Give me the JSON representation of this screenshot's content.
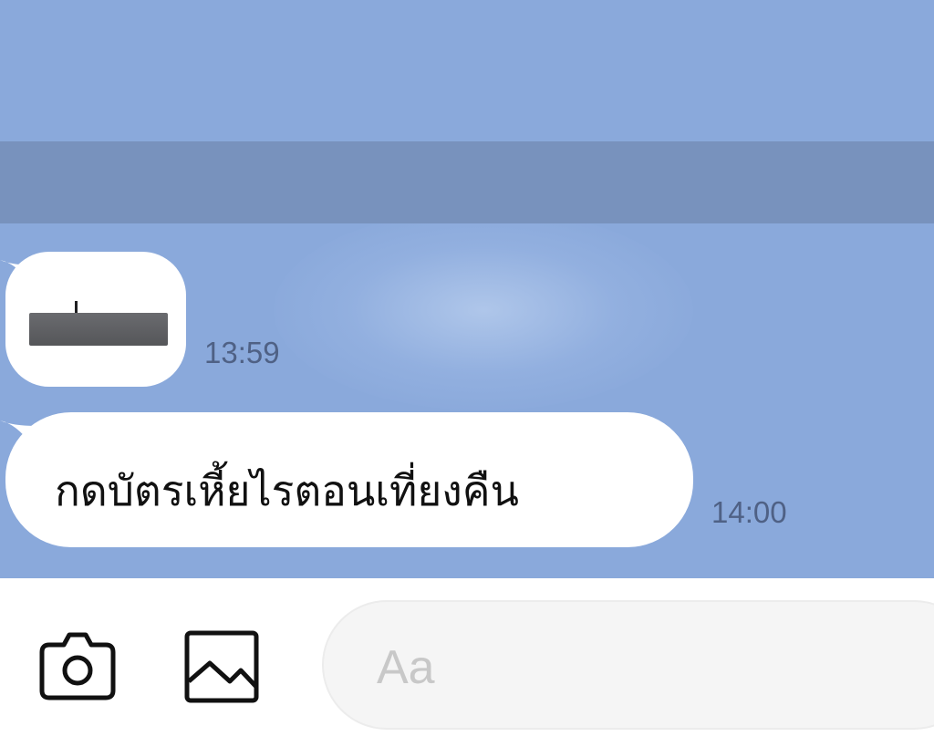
{
  "chat": {
    "messages": [
      {
        "type": "sticker",
        "time": "13:59"
      },
      {
        "type": "text",
        "text": "กดบัตรเหี้ยไรตอนเที่ยงคืน",
        "time": "14:00"
      }
    ]
  },
  "composer": {
    "placeholder": "Aa",
    "icons": {
      "camera": "camera-icon",
      "gallery": "image-icon"
    }
  },
  "colors": {
    "chat_background": "#8aa9db",
    "header_band": "#7892bd",
    "bubble": "#ffffff",
    "timestamp": "#4f6185",
    "placeholder": "#c8c8c8"
  }
}
